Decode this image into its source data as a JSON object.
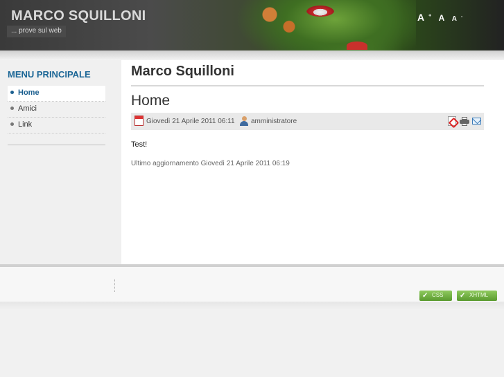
{
  "header": {
    "site_title": "MARCO SQUILLONI",
    "site_subtitle": "... prove sul web",
    "font_controls": {
      "increase": "A",
      "increase_mark": "+",
      "reset": "A",
      "decrease": "A",
      "decrease_mark": "-"
    }
  },
  "sidebar": {
    "menu_title": "MENU PRINCIPALE",
    "items": [
      {
        "label": "Home",
        "active": true
      },
      {
        "label": "Amici",
        "active": false
      },
      {
        "label": "Link",
        "active": false
      }
    ]
  },
  "main": {
    "page_title": "Marco Squilloni",
    "article": {
      "title": "Home",
      "date": "Giovedì 21 Aprile 2011 06:11",
      "author": "amministratore",
      "body": "Test!",
      "last_update": "Ultimo aggiornamento Giovedì 21 Aprile 2011 06:19"
    }
  },
  "footer": {
    "valid_css": "CSS",
    "valid_xhtml": "XHTML"
  },
  "colors": {
    "accent_blue": "#1b6696",
    "valid_green": "#6aab3c"
  }
}
